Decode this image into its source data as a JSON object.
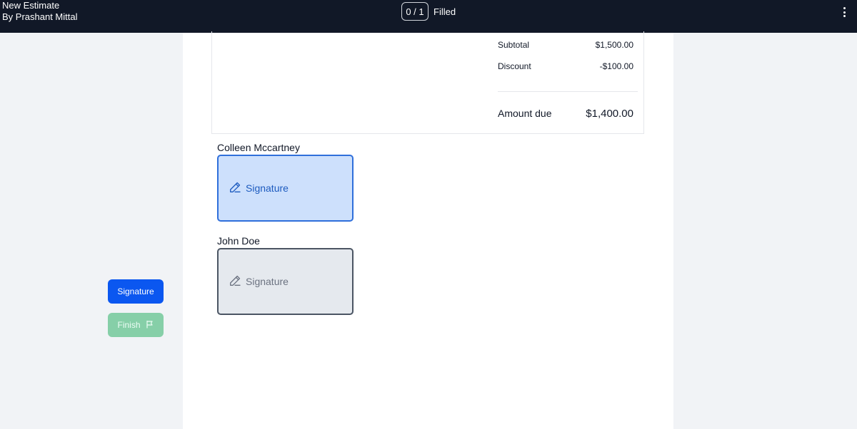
{
  "header": {
    "title": "New Estimate",
    "author": "By Prashant Mittal",
    "progress_count": "0 / 1",
    "progress_label": "Filled",
    "menu_icon": "more-vertical-icon"
  },
  "actions": {
    "signature_label": "Signature",
    "finish_label": "Finish",
    "finish_icon": "flag-icon"
  },
  "totals": {
    "subtotal_label": "Subtotal",
    "subtotal_value": "$1,500.00",
    "discount_label": "Discount",
    "discount_value": "-$100.00",
    "amount_due_label": "Amount due",
    "amount_due_value": "$1,400.00"
  },
  "signers": [
    {
      "name": "Colleen Mccartney",
      "field_label": "Signature",
      "icon": "pen-icon"
    },
    {
      "name": "John Doe",
      "field_label": "Signature",
      "icon": "pen-icon"
    }
  ],
  "colors": {
    "topbar": "#111827",
    "primary": "#0b57f0",
    "finish_disabled": "#86cfa8",
    "active_field_bg": "#cde0fc",
    "active_field_border": "#2f6fdb",
    "inactive_field_bg": "#e5e9ee"
  }
}
